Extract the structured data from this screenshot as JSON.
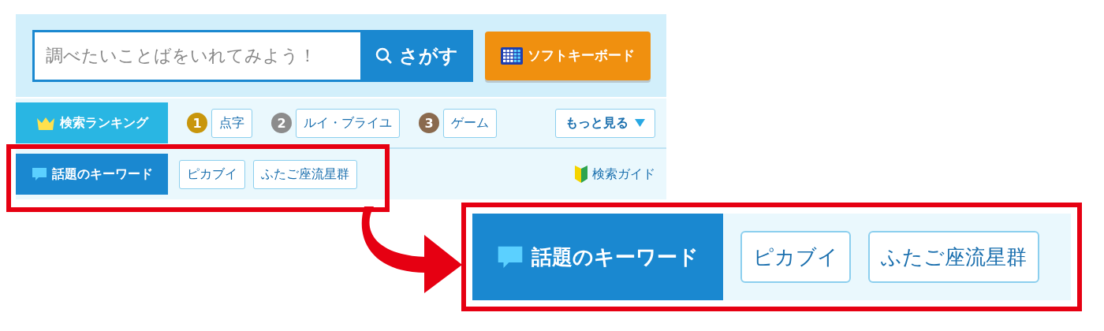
{
  "search": {
    "placeholder": "調べたいことばをいれてみよう！",
    "button": "さがす",
    "keyboard_button": "ソフトキーボード"
  },
  "ranking": {
    "label": "検索ランキング",
    "items": [
      {
        "rank": "1",
        "color": "#c8960c",
        "keyword": "点字"
      },
      {
        "rank": "2",
        "color": "#8c8c8c",
        "keyword": "ルイ・ブライユ"
      },
      {
        "rank": "3",
        "color": "#8a6a4e",
        "keyword": "ゲーム"
      }
    ],
    "more_button": "もっと見る"
  },
  "trending": {
    "label": "話題のキーワード",
    "keywords": [
      "ピカブイ",
      "ふたご座流星群"
    ],
    "guide_link": "検索ガイド"
  },
  "callout": {
    "label": "話題のキーワード",
    "keywords": [
      "ピカブイ",
      "ふたご座流星群"
    ]
  }
}
